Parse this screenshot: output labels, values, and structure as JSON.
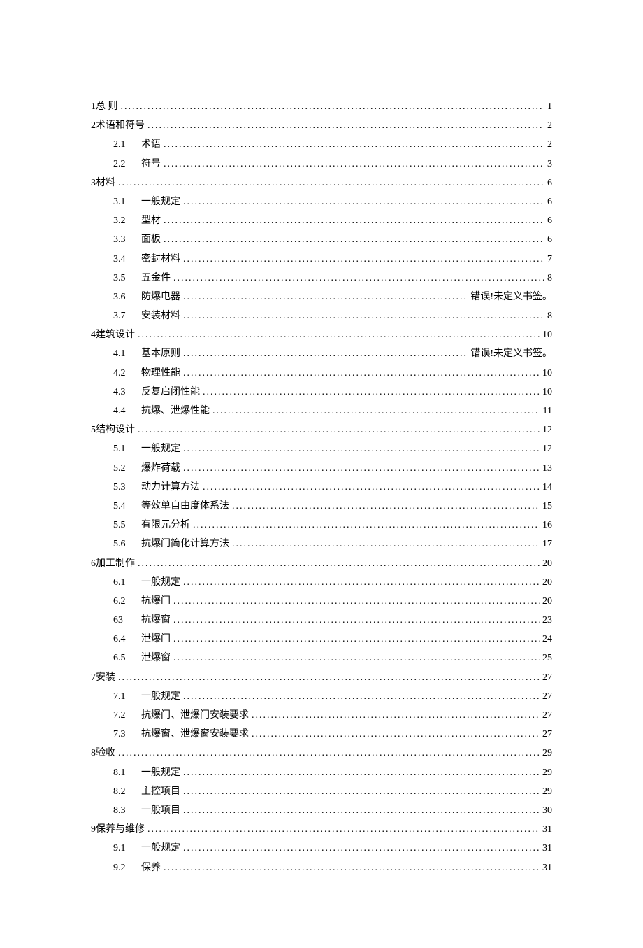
{
  "toc": [
    {
      "level": 0,
      "num": "1",
      "title": "总 则",
      "page": "1"
    },
    {
      "level": 0,
      "num": "2",
      "title": "术语和符号",
      "page": "2"
    },
    {
      "level": 1,
      "num": "2.1",
      "title": "术语",
      "page": "2"
    },
    {
      "level": 1,
      "num": "2.2",
      "title": "符号",
      "page": "3"
    },
    {
      "level": 0,
      "num": "3",
      "title": "材料",
      "page": "6"
    },
    {
      "level": 1,
      "num": "3.1",
      "title": "一般规定",
      "page": "6"
    },
    {
      "level": 1,
      "num": "3.2",
      "title": "型材",
      "page": "6"
    },
    {
      "level": 1,
      "num": "3.3",
      "title": "面板",
      "page": "6"
    },
    {
      "level": 1,
      "num": "3.4",
      "title": "密封材料",
      "page": "7"
    },
    {
      "level": 1,
      "num": "3.5",
      "title": "五金件",
      "page": "8"
    },
    {
      "level": 1,
      "num": "3.6",
      "title": "防爆电器",
      "page": "错误!未定义书签。"
    },
    {
      "level": 1,
      "num": "3.7",
      "title": "安装材料",
      "page": "8"
    },
    {
      "level": 0,
      "num": "4",
      "title": "建筑设计",
      "page": "10"
    },
    {
      "level": 1,
      "num": "4.1",
      "title": "基本原则",
      "page": "错误!未定义书签。"
    },
    {
      "level": 1,
      "num": "4.2",
      "title": "物理性能",
      "page": "10"
    },
    {
      "level": 1,
      "num": "4.3",
      "title": "反复启闭性能",
      "page": "10"
    },
    {
      "level": 1,
      "num": "4.4",
      "title": "抗爆、泄爆性能",
      "page": "11"
    },
    {
      "level": 0,
      "num": "5",
      "title": "结构设计",
      "page": "12"
    },
    {
      "level": 1,
      "num": "5.1",
      "title": "一般规定",
      "page": "12"
    },
    {
      "level": 1,
      "num": "5.2",
      "title": "爆炸荷载",
      "page": "13"
    },
    {
      "level": 1,
      "num": "5.3",
      "title": "动力计算方法",
      "page": "14"
    },
    {
      "level": 1,
      "num": "5.4",
      "title": "等效单自由度体系法",
      "page": "15"
    },
    {
      "level": 1,
      "num": "5.5",
      "title": "有限元分析",
      "page": "16"
    },
    {
      "level": 1,
      "num": "5.6",
      "title": "抗爆门简化计算方法",
      "page": "17"
    },
    {
      "level": 0,
      "num": "6",
      "title": "加工制作",
      "page": "20"
    },
    {
      "level": 1,
      "num": "6.1",
      "title": "一般规定",
      "page": "20"
    },
    {
      "level": 1,
      "num": "6.2",
      "title": "抗爆门",
      "page": "20"
    },
    {
      "level": 1,
      "num": "63",
      "title": "抗爆窗",
      "page": "23"
    },
    {
      "level": 1,
      "num": "6.4",
      "title": "泄爆门",
      "page": "24"
    },
    {
      "level": 1,
      "num": "6.5",
      "title": "泄爆窗",
      "page": "25"
    },
    {
      "level": 0,
      "num": "7",
      "title": "安装",
      "page": "27"
    },
    {
      "level": 1,
      "num": "7.1",
      "title": "一般规定",
      "page": "27"
    },
    {
      "level": 1,
      "num": "7.2",
      "title": "抗爆门、泄爆门安装要求",
      "page": "27"
    },
    {
      "level": 1,
      "num": "7.3",
      "title": "抗爆窗、泄爆窗安装要求",
      "page": "27"
    },
    {
      "level": 0,
      "num": "8",
      "title": "验收",
      "page": "29"
    },
    {
      "level": 1,
      "num": "8.1",
      "title": "一般规定",
      "page": "29"
    },
    {
      "level": 1,
      "num": "8.2",
      "title": "主控项目",
      "page": "29"
    },
    {
      "level": 1,
      "num": "8.3",
      "title": "一般项目",
      "page": "30"
    },
    {
      "level": 0,
      "num": "9",
      "title": "保养与维修",
      "page": "31"
    },
    {
      "level": 1,
      "num": "9.1",
      "title": "一般规定",
      "page": "31"
    },
    {
      "level": 1,
      "num": "9.2",
      "title": "保养",
      "page": "31"
    }
  ]
}
